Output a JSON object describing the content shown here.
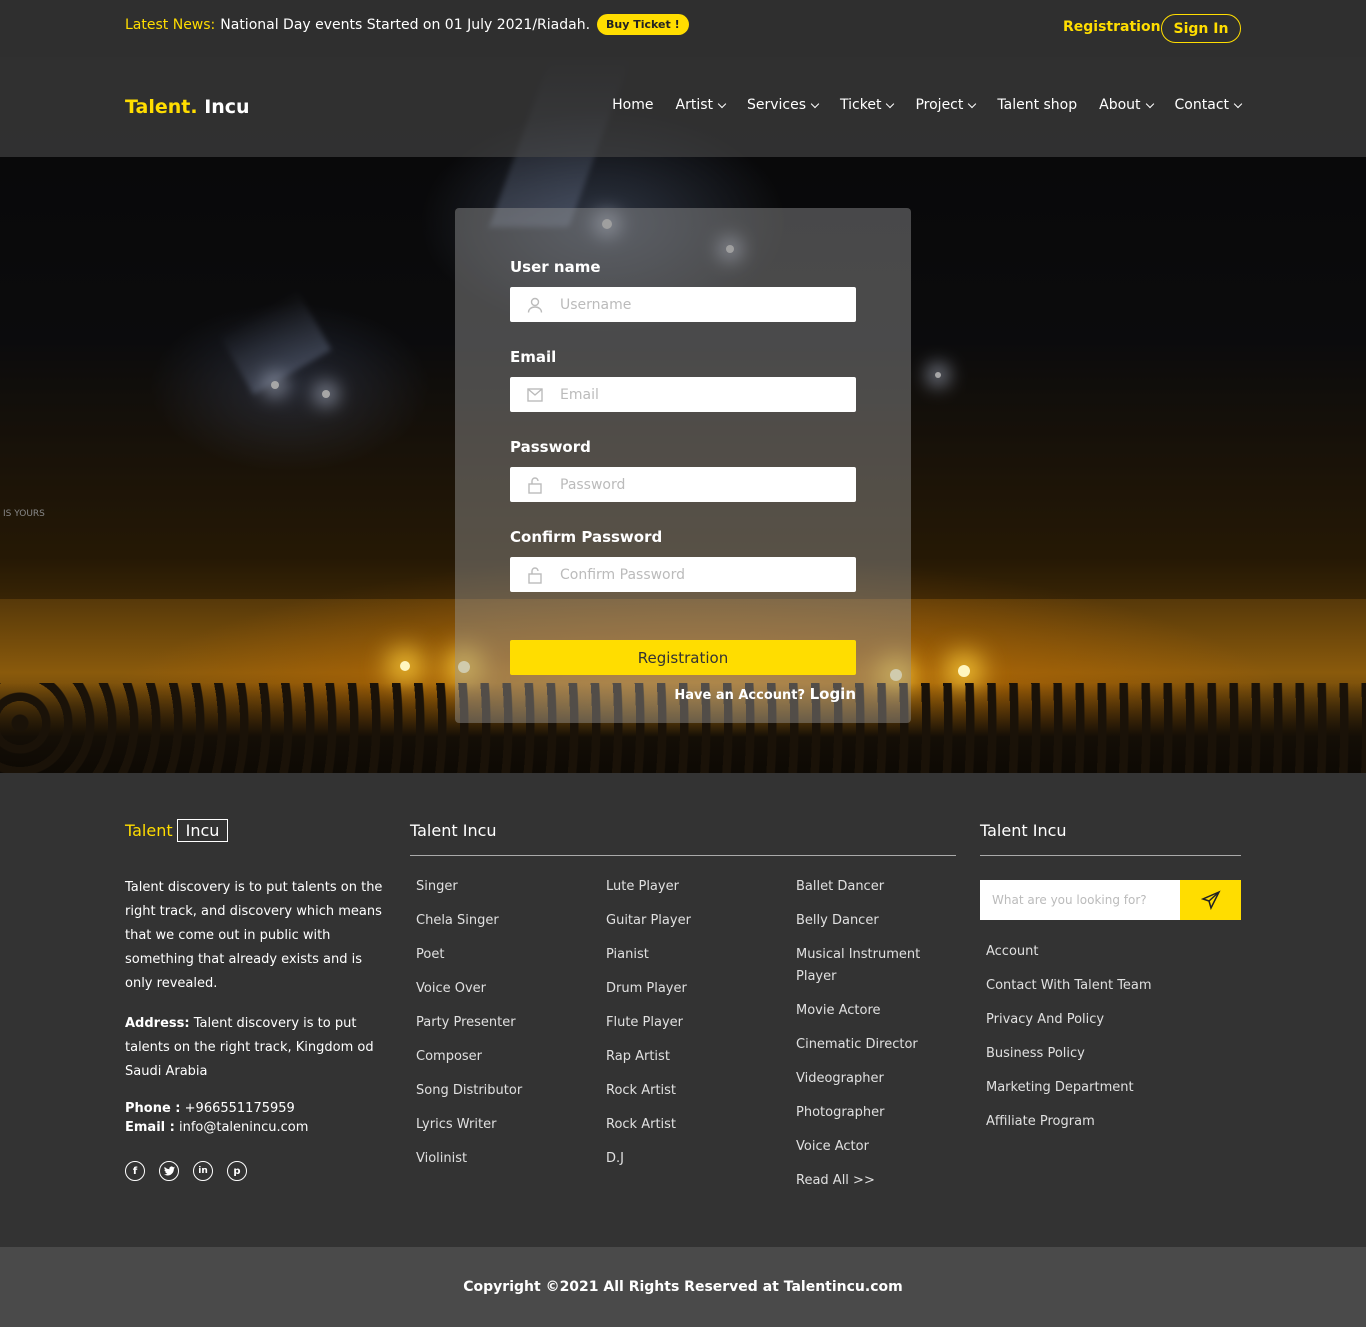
{
  "topbar": {
    "news_label": "Latest News:",
    "news_text": "National Day events Started on 01 July 2021/Riadah.",
    "buy_ticket": "Buy Ticket !",
    "registration": "Registration",
    "sign_in": "Sign In"
  },
  "header": {
    "logo_part1": "Talent.",
    "logo_part2": "Incu",
    "nav": [
      {
        "label": "Home"
      },
      {
        "label": "Artist"
      },
      {
        "label": "Services"
      },
      {
        "label": "Ticket"
      },
      {
        "label": "Project"
      },
      {
        "label": "Talent shop"
      },
      {
        "label": "About"
      },
      {
        "label": "Contact"
      }
    ]
  },
  "hero_text": "IS YOURS",
  "form": {
    "username_label": "User name",
    "username_placeholder": "Username",
    "email_label": "Email",
    "email_placeholder": "Email",
    "password_label": "Password",
    "password_placeholder": "Password",
    "confirm_label": "Confirm Password",
    "confirm_placeholder": "Confirm Password",
    "submit": "Registration",
    "have_account": "Have an Account?",
    "login": "Login"
  },
  "footer": {
    "logo_part1": "Talent",
    "logo_part2": "Incu",
    "about": "Talent discovery is to put talents on the right track, and discovery which means that we come out in public with something that already exists and is only revealed.",
    "address_label": "Address:",
    "address": "Talent discovery is to put talents on the right track, Kingdom od Saudi Arabia",
    "phone_label": "Phone :",
    "phone": "+966551175959",
    "email_label": "Email :",
    "email": "info@talenincu.com",
    "socials": [
      "facebook-icon",
      "twitter-icon",
      "linkedin-icon",
      "pinterest-icon"
    ],
    "col2_title": "Talent Incu",
    "col2a": [
      "Singer",
      "Chela Singer",
      "Poet",
      "Voice Over",
      "Party Presenter",
      "Composer",
      "Song Distributor",
      "Lyrics Writer",
      "Violinist"
    ],
    "col2b": [
      "Lute Player",
      "Guitar Player",
      "Pianist",
      "Drum Player",
      "Flute Player",
      "Rap Artist",
      "Rock Artist",
      "Rock Artist",
      "D.J"
    ],
    "col2c": [
      "Ballet Dancer",
      "Belly Dancer",
      "Musical Instrument Player",
      "Movie Actore",
      "Cinematic Director",
      "Videographer",
      "Photographer",
      "Voice Actor",
      "Read All >>"
    ],
    "col3_title": "Talent Incu",
    "search_placeholder": "What are you looking for?",
    "col3": [
      "Account",
      "Contact With Talent Team",
      "Privacy And Policy",
      "Business Policy",
      "Marketing Department",
      "Affiliate Program"
    ],
    "copyright": "Copyright ©2021 All Rights Reserved at Talentincu.com"
  },
  "colors": {
    "accent": "#ffdd00",
    "dark": "#333333",
    "topbar": "#2f2f2f",
    "copyright_bg": "#4a4a4a"
  }
}
